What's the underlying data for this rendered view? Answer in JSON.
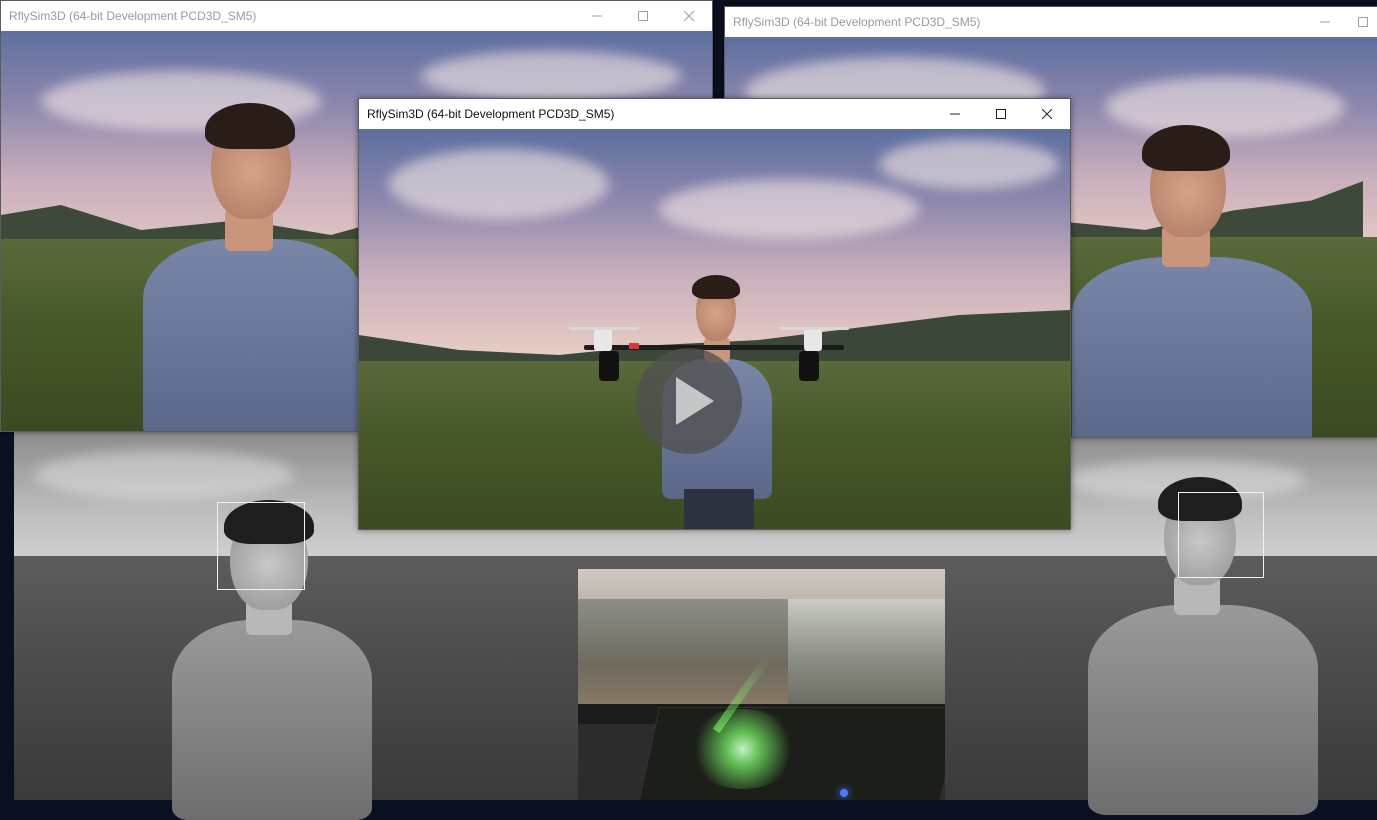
{
  "windows": {
    "top_left": {
      "title": "RflySim3D (64-bit Development PCD3D_SM5)"
    },
    "top_right": {
      "title": "RflySim3D (64-bit Development PCD3D_SM5)"
    },
    "center": {
      "title": "RflySim3D (64-bit Development PCD3D_SM5)"
    }
  },
  "controls": {
    "minimize": "minimize-icon",
    "maximize": "maximize-icon",
    "close": "close-icon"
  },
  "overlay": {
    "play": "play-icon"
  },
  "colors": {
    "face_box": "#f2f2f2",
    "led_green": "#7dff6a",
    "led_blue": "#4a7bff"
  }
}
